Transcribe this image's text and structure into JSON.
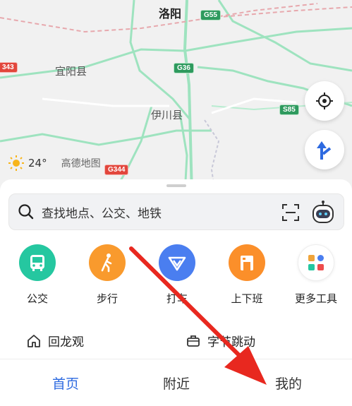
{
  "map": {
    "labels": {
      "luoyang": "洛阳",
      "yiyang": "宜阳县",
      "yichuan": "伊川县"
    },
    "shields": {
      "g55": "G55",
      "g36": "G36",
      "s85": "S85",
      "g344": "G344",
      "edge": "343"
    }
  },
  "weather": {
    "temp": "24°",
    "brand": "高德地图"
  },
  "search": {
    "placeholder": "查找地点、公交、地铁"
  },
  "quick_actions": [
    {
      "label": "公交",
      "color": "#25c7a0"
    },
    {
      "label": "步行",
      "color": "#f99a2d"
    },
    {
      "label": "打车",
      "color": "#4a7ef0"
    },
    {
      "label": "上下班",
      "color": "#fb8f2a"
    },
    {
      "label": "更多工具",
      "color": "#ffffff"
    }
  ],
  "recent": [
    {
      "label": "回龙观"
    },
    {
      "label": "字节跳动"
    }
  ],
  "tabs": [
    {
      "label": "首页"
    },
    {
      "label": "附近"
    },
    {
      "label": "我的"
    }
  ],
  "colors": {
    "accent": "#2d6ae0",
    "arrow": "#e8281f",
    "road": "#7fd9a8"
  }
}
